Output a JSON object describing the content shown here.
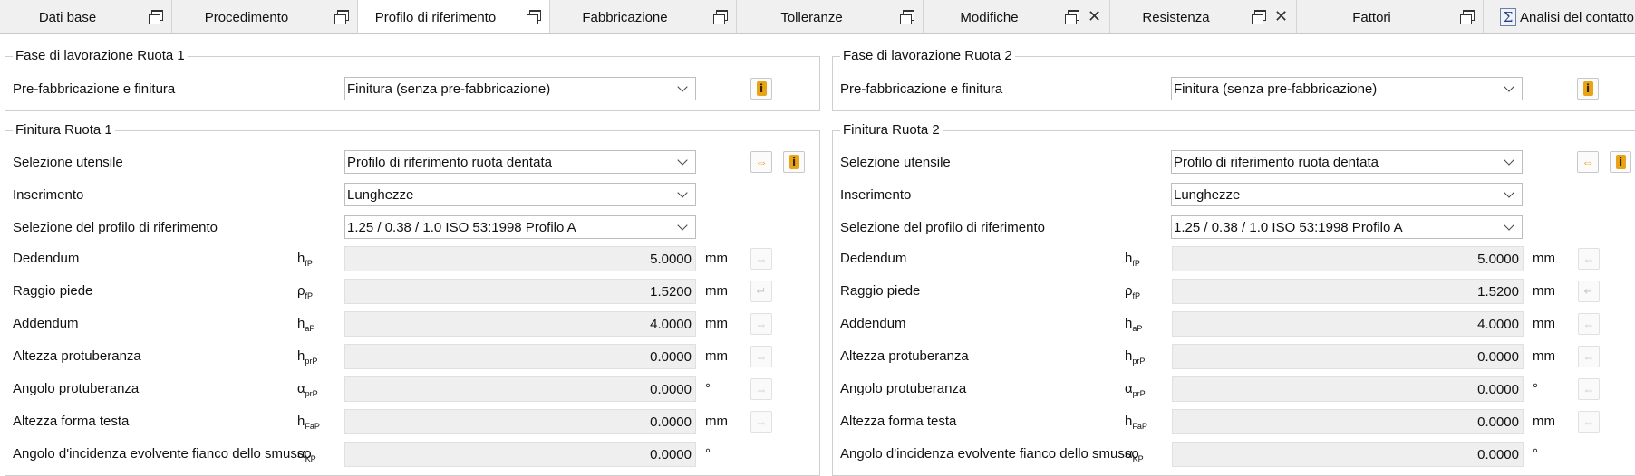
{
  "tabs": [
    {
      "label": "Dati base",
      "icons": [
        "restore"
      ]
    },
    {
      "label": "Procedimento",
      "icons": [
        "restore"
      ]
    },
    {
      "label": "Profilo di riferimento",
      "icons": [
        "restore"
      ],
      "active": true
    },
    {
      "label": "Fabbricazione",
      "icons": [
        "restore"
      ]
    },
    {
      "label": "Tolleranze",
      "icons": [
        "restore"
      ]
    },
    {
      "label": "Modifiche",
      "icons": [
        "restore",
        "close"
      ]
    },
    {
      "label": "Resistenza",
      "icons": [
        "restore",
        "close"
      ]
    },
    {
      "label": "Fattori",
      "icons": [
        "restore"
      ]
    },
    {
      "label": "Analisi del contatto",
      "icons": [
        "sum"
      ]
    }
  ],
  "wheel1": {
    "phase_title": "Fase di lavorazione Ruota 1",
    "prefab_label": "Pre-fabbricazione e finitura",
    "prefab_value": "Finitura (senza pre-fabbricazione)",
    "finish_title": "Finitura Ruota 1",
    "tool_label": "Selezione utensile",
    "tool_value": "Profilo di riferimento ruota dentata",
    "input_label": "Inserimento",
    "input_value": "Lunghezze",
    "profile_label": "Selezione del profilo di riferimento",
    "profile_value": "1.25 / 0.38 / 1.0 ISO 53:1998 Profilo A",
    "rows": [
      {
        "label": "Dedendum",
        "sym": "h",
        "sub": "fP",
        "value": "5.0000",
        "unit": "mm",
        "lock": "swap"
      },
      {
        "label": "Raggio piede",
        "sym": "ρ",
        "sub": "fP",
        "value": "1.5200",
        "unit": "mm",
        "lock": "return"
      },
      {
        "label": "Addendum",
        "sym": "h",
        "sub": "aP",
        "value": "4.0000",
        "unit": "mm",
        "lock": "swap"
      },
      {
        "label": "Altezza protuberanza",
        "sym": "h",
        "sub": "prP",
        "value": "0.0000",
        "unit": "mm",
        "lock": "swap"
      },
      {
        "label": "Angolo protuberanza",
        "sym": "α",
        "sub": "prP",
        "value": "0.0000",
        "unit": "°",
        "lock": "swap"
      },
      {
        "label": "Altezza forma testa",
        "sym": "h",
        "sub": "FaP",
        "value": "0.0000",
        "unit": "mm",
        "lock": "swap"
      },
      {
        "label": "Angolo d'incidenza evolvente fianco dello smusso",
        "sym": "α",
        "sub": "KP",
        "value": "0.0000",
        "unit": "°",
        "lock": "none"
      }
    ]
  },
  "wheel2": {
    "phase_title": "Fase di lavorazione Ruota 2",
    "prefab_label": "Pre-fabbricazione e finitura",
    "prefab_value": "Finitura (senza pre-fabbricazione)",
    "finish_title": "Finitura Ruota 2",
    "tool_label": "Selezione utensile",
    "tool_value": "Profilo di riferimento ruota dentata",
    "input_label": "Inserimento",
    "input_value": "Lunghezze",
    "profile_label": "Selezione del profilo di riferimento",
    "profile_value": "1.25 / 0.38 / 1.0 ISO 53:1998 Profilo A",
    "rows": [
      {
        "label": "Dedendum",
        "sym": "h",
        "sub": "fP",
        "value": "5.0000",
        "unit": "mm",
        "lock": "swap"
      },
      {
        "label": "Raggio piede",
        "sym": "ρ",
        "sub": "fP",
        "value": "1.5200",
        "unit": "mm",
        "lock": "return"
      },
      {
        "label": "Addendum",
        "sym": "h",
        "sub": "aP",
        "value": "4.0000",
        "unit": "mm",
        "lock": "swap"
      },
      {
        "label": "Altezza protuberanza",
        "sym": "h",
        "sub": "prP",
        "value": "0.0000",
        "unit": "mm",
        "lock": "swap"
      },
      {
        "label": "Angolo protuberanza",
        "sym": "α",
        "sub": "prP",
        "value": "0.0000",
        "unit": "°",
        "lock": "swap"
      },
      {
        "label": "Altezza forma testa",
        "sym": "h",
        "sub": "FaP",
        "value": "0.0000",
        "unit": "mm",
        "lock": "swap"
      },
      {
        "label": "Angolo d'incidenza evolvente fianco dello smusso",
        "sym": "α",
        "sub": "KP",
        "value": "0.0000",
        "unit": "°",
        "lock": "none"
      }
    ]
  },
  "icons": {
    "info": "i",
    "swap": "⇔",
    "return": "↵",
    "sum": "Σ",
    "close": "✕"
  }
}
